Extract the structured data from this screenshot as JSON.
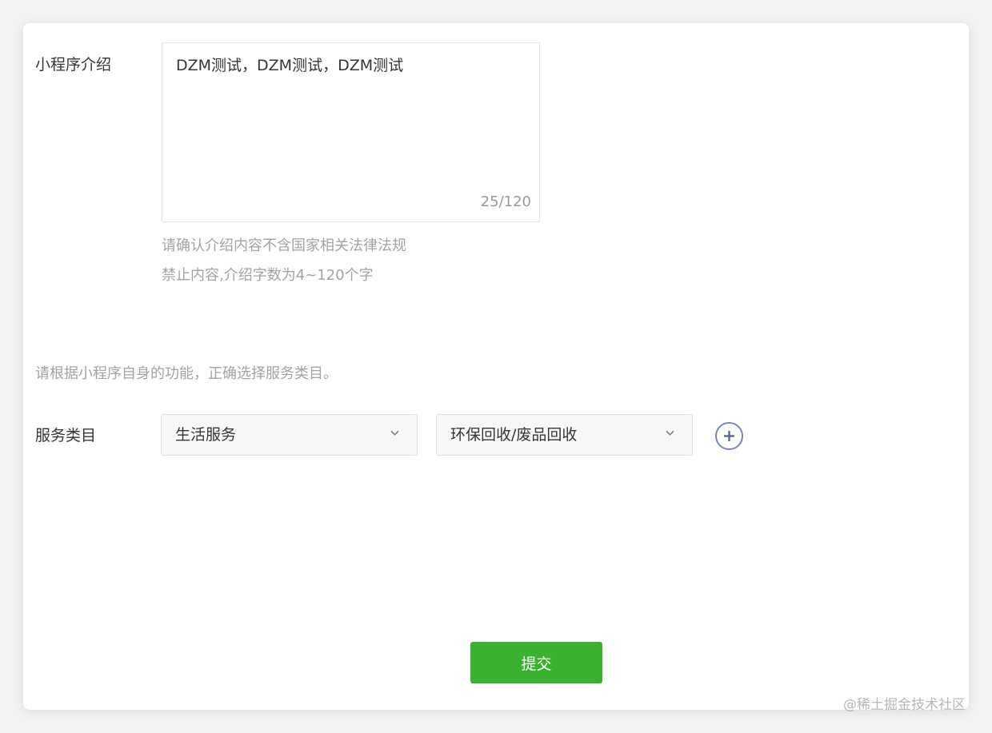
{
  "form": {
    "intro": {
      "label": "小程序介绍",
      "value": "DZM测试，DZM测试，DZM测试",
      "counter": "25/120",
      "tips": [
        "请确认介绍内容不含国家相关法律法规",
        "禁止内容,介绍字数为4~120个字"
      ]
    },
    "service": {
      "hint": "请根据小程序自身的功能，正确选择服务类目。",
      "label": "服务类目",
      "category_primary": "生活服务",
      "category_secondary": "环保回收/废品回收",
      "add_icon": "plus-circle-icon",
      "dropdown_icon": "chevron-down-icon"
    },
    "submit_label": "提交"
  },
  "watermark": "@稀土掘金技术社区",
  "colors": {
    "primary_button": "#3ab22f",
    "add_icon_stroke": "#7a88ad",
    "text": "#353535",
    "hint_text": "#a3a3a3"
  }
}
